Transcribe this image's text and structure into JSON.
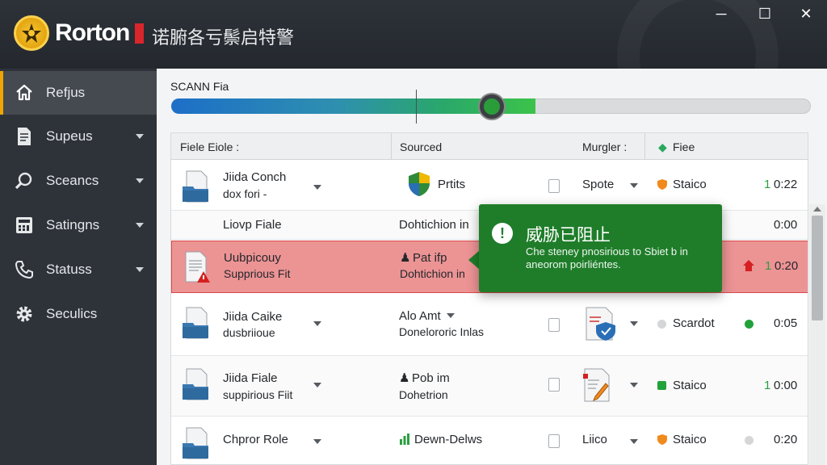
{
  "app": {
    "brand": "Rorton",
    "title": "诺腑各亏鬃启特警",
    "accent": "#f0a500",
    "brand_red": "#d8262b"
  },
  "window_controls": {
    "minimize": "─",
    "maximize": "☐",
    "close": "✕"
  },
  "sidebar": {
    "items": [
      {
        "label": "Refjus",
        "icon": "home-icon",
        "active": true,
        "has_caret": false
      },
      {
        "label": "Supeus",
        "icon": "document-icon",
        "active": false,
        "has_caret": true
      },
      {
        "label": "Sceancs",
        "icon": "magnifier-icon",
        "active": false,
        "has_caret": true
      },
      {
        "label": "Satingns",
        "icon": "calculator-icon",
        "active": false,
        "has_caret": true
      },
      {
        "label": "Statuss",
        "icon": "phone-icon",
        "active": false,
        "has_caret": true
      },
      {
        "label": "Seculics",
        "icon": "gear-icon",
        "active": false,
        "has_caret": false
      }
    ]
  },
  "scan": {
    "label": "SCANN Fia",
    "progress": 0.57
  },
  "table": {
    "headers": {
      "file": "Fiele Eiole :",
      "source": "Sourced",
      "murgler": "Murgler :",
      "free": "Fiee"
    },
    "rows": [
      {
        "name": "Jiida Conch",
        "sub": "dox fori -",
        "source": "Prtits",
        "action": "Spote",
        "status": "Staico",
        "count": "1",
        "time": "0:22"
      },
      {
        "name": "Liovp Fiale",
        "source": "Dohtichion in",
        "time": "0:00"
      },
      {
        "name": "Uubpicouy",
        "sub": "Supprious Fit",
        "source": "Pat ifp",
        "source_sub": "Dohtichion in",
        "count": "1",
        "time": "0:20"
      },
      {
        "name": "Jiida Caike",
        "sub": "dusbriioue",
        "source": "Alo Amt",
        "source_sub": "Donelororic Inlas",
        "status": "Scardot",
        "time": "0:05"
      },
      {
        "name": "Jiida Fiale",
        "sub": "suppirious Fiit",
        "source": "Pob im",
        "source_sub": "Dohetrion",
        "status": "Staico",
        "count": "1",
        "time": "0:00"
      },
      {
        "name": "Chpror Role",
        "source": "Dewn-Delws",
        "action": "Liico",
        "status": "Staico",
        "time": "0:20"
      }
    ]
  },
  "toast": {
    "title": "威胁已阻止",
    "message": "Che steney pnosirious to Sbiet b in aneorom poirliéntes.",
    "icon": "exclamation-icon",
    "color": "#1f7d2a"
  }
}
